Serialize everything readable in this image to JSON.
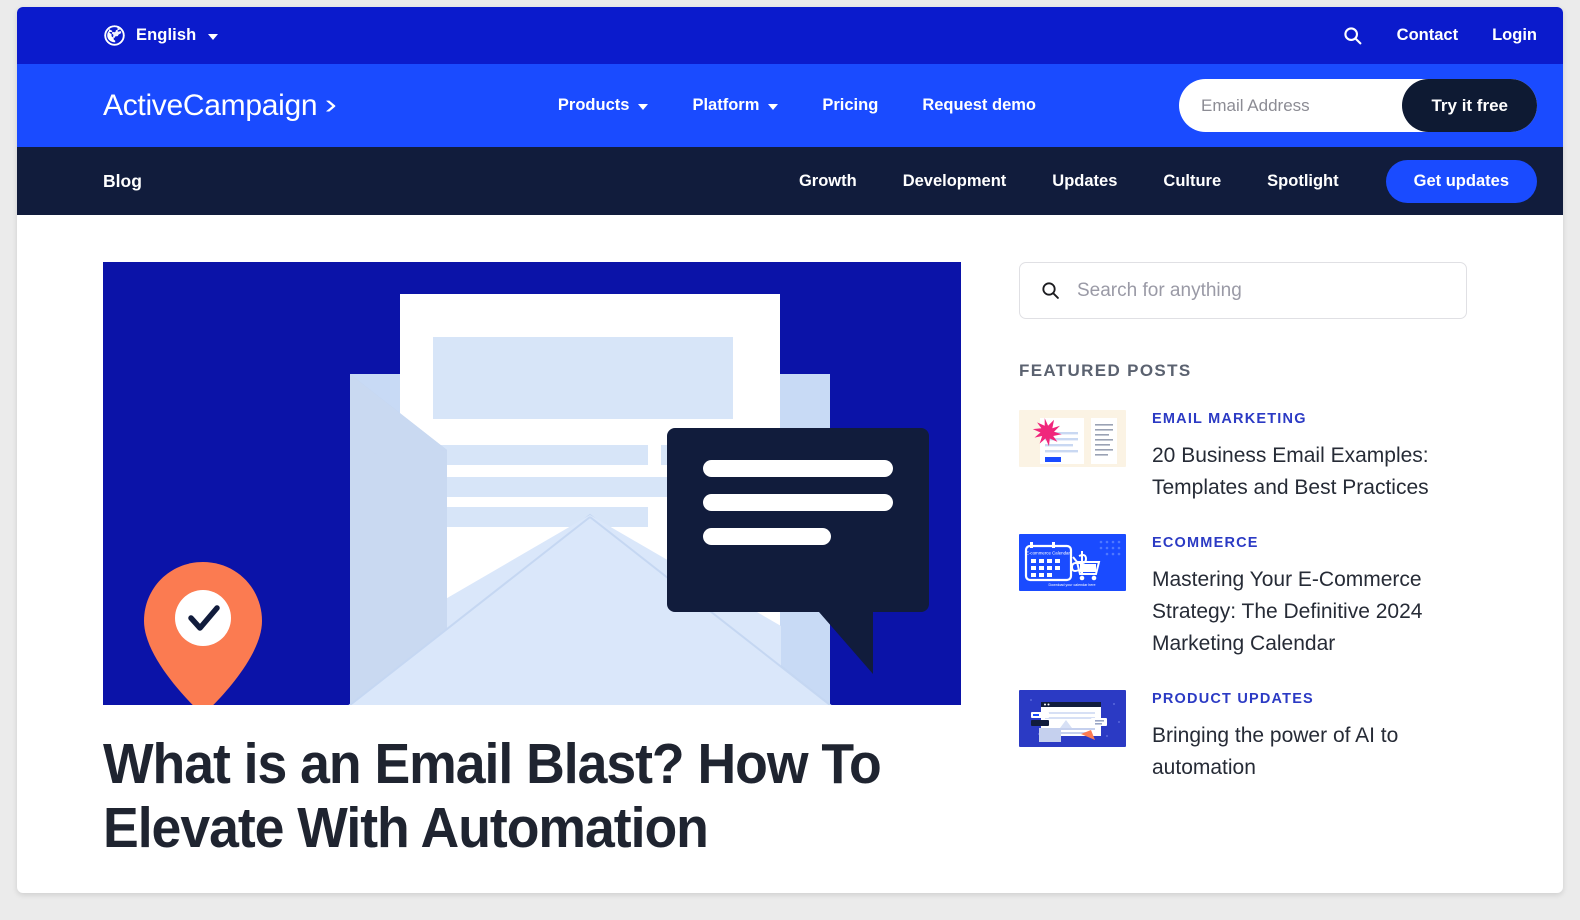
{
  "utility_bar": {
    "language": "English",
    "globe_icon": "globe-icon",
    "search_icon": "search-icon",
    "links": [
      {
        "label": "Contact"
      },
      {
        "label": "Login"
      }
    ]
  },
  "main_nav": {
    "logo_text": "ActiveCampaign",
    "logo_mark": "chevron-right-mark",
    "items": [
      {
        "label": "Products",
        "has_dropdown": true
      },
      {
        "label": "Platform",
        "has_dropdown": true
      },
      {
        "label": "Pricing",
        "has_dropdown": false
      },
      {
        "label": "Request demo",
        "has_dropdown": false
      }
    ],
    "email_placeholder": "Email Address",
    "email_value": "",
    "cta_label": "Try it free"
  },
  "blog_nav": {
    "brand": "Blog",
    "items": [
      {
        "label": "Growth"
      },
      {
        "label": "Development"
      },
      {
        "label": "Updates"
      },
      {
        "label": "Culture"
      },
      {
        "label": "Spotlight"
      }
    ],
    "cta_label": "Get updates"
  },
  "article": {
    "title": "What is an Email Blast? How To Elevate With Automation",
    "hero_alt": "envelope-with-letter-chat-bubble-and-location-pin-illustration"
  },
  "sidebar": {
    "search_placeholder": "Search for anything",
    "search_value": "",
    "search_icon": "search-icon",
    "featured_heading": "FEATURED POSTS",
    "posts": [
      {
        "category": "EMAIL MARKETING",
        "title": "20 Business Email Examples: Templates and Best Practices",
        "thumb": "email-template-starburst-thumbnail"
      },
      {
        "category": "ECOMMERCE",
        "title": "Mastering Your E-Commerce Strategy: The Definitive 2024 Marketing Calendar",
        "thumb": "ecommerce-calendar-cart-thumbnail"
      },
      {
        "category": "PRODUCT UPDATES",
        "title": "Bringing the power of AI to automation",
        "thumb": "ai-automation-dashboard-thumbnail"
      }
    ]
  },
  "colors": {
    "utility_blue": "#0B1BCC",
    "nav_blue": "#1A4BFF",
    "blog_navy": "#111C3C",
    "hero_blue": "#0B13A8",
    "dark_button": "#0E1A33",
    "category_blue": "#2B3AC4",
    "accent_orange": "#FB7B51",
    "page_bg": "#EBEBEB"
  }
}
